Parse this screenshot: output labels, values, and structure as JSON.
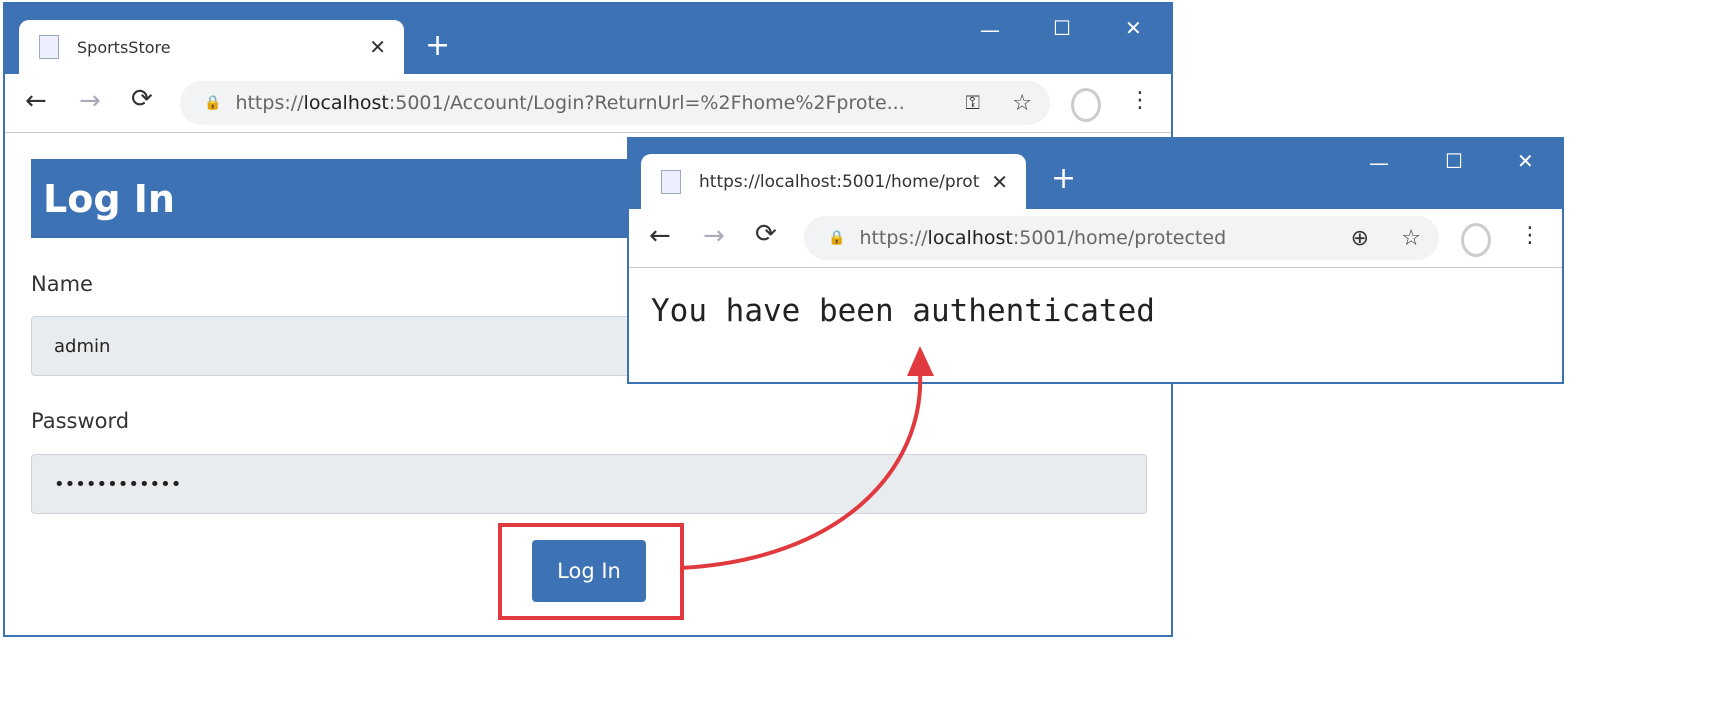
{
  "window1": {
    "tab_title": "SportsStore",
    "url_scheme": "https://",
    "url_host": "localhost",
    "url_rest": ":5001/Account/Login?ReturnUrl=%2Fhome%2Fprote...",
    "page": {
      "heading": "Log In",
      "name_label": "Name",
      "name_value": "admin",
      "password_label": "Password",
      "password_value": "••••••••••••",
      "login_button": "Log In"
    }
  },
  "window2": {
    "tab_title": "https://localhost:5001/home/prot",
    "url_scheme": "https://",
    "url_host": "localhost",
    "url_rest": ":5001/home/protected",
    "message": "You have been authenticated"
  },
  "icons": {
    "close": "✕",
    "new_tab": "+",
    "minimize": "—",
    "maximize": "☐",
    "back": "←",
    "forward": "→",
    "reload": "⟳",
    "lock": "🔒",
    "key": "⚿",
    "star": "☆",
    "zoom": "⊕",
    "menu": "⋮"
  },
  "colors": {
    "brand": "#3d73b5",
    "highlight": "#e0393e"
  }
}
